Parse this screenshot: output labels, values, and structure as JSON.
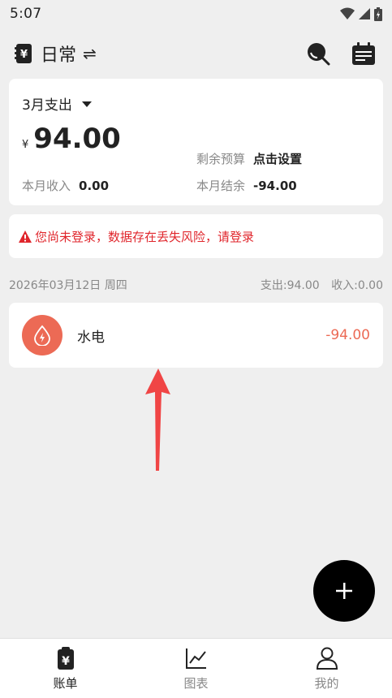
{
  "status_bar": {
    "time": "5:07"
  },
  "app_bar": {
    "title": "日常",
    "swap_glyph": "⇌"
  },
  "summary": {
    "month_label": "3月支出",
    "currency": "¥",
    "amount": "94.00",
    "budget_label": "剩余预算",
    "budget_action": "点击设置",
    "income_label": "本月收入",
    "income_value": "0.00",
    "balance_label": "本月结余",
    "balance_value": "-94.00"
  },
  "warning": {
    "text": "您尚未登录，数据存在丢失风险，请登录"
  },
  "day_group": {
    "date": "2026年03月12日 周四",
    "expense": "支出:94.00",
    "income": "收入:0.00"
  },
  "transactions": [
    {
      "category": "水电",
      "amount": "-94.00",
      "icon": "water-drop-icon"
    }
  ],
  "bottom_nav": [
    {
      "label": "账单",
      "icon": "bill-icon",
      "active": true
    },
    {
      "label": "图表",
      "icon": "chart-icon",
      "active": false
    },
    {
      "label": "我的",
      "icon": "person-icon",
      "active": false
    }
  ],
  "colors": {
    "accent": "#ec6a55",
    "warning": "#e0262c",
    "annotation_arrow": "#f04545"
  }
}
